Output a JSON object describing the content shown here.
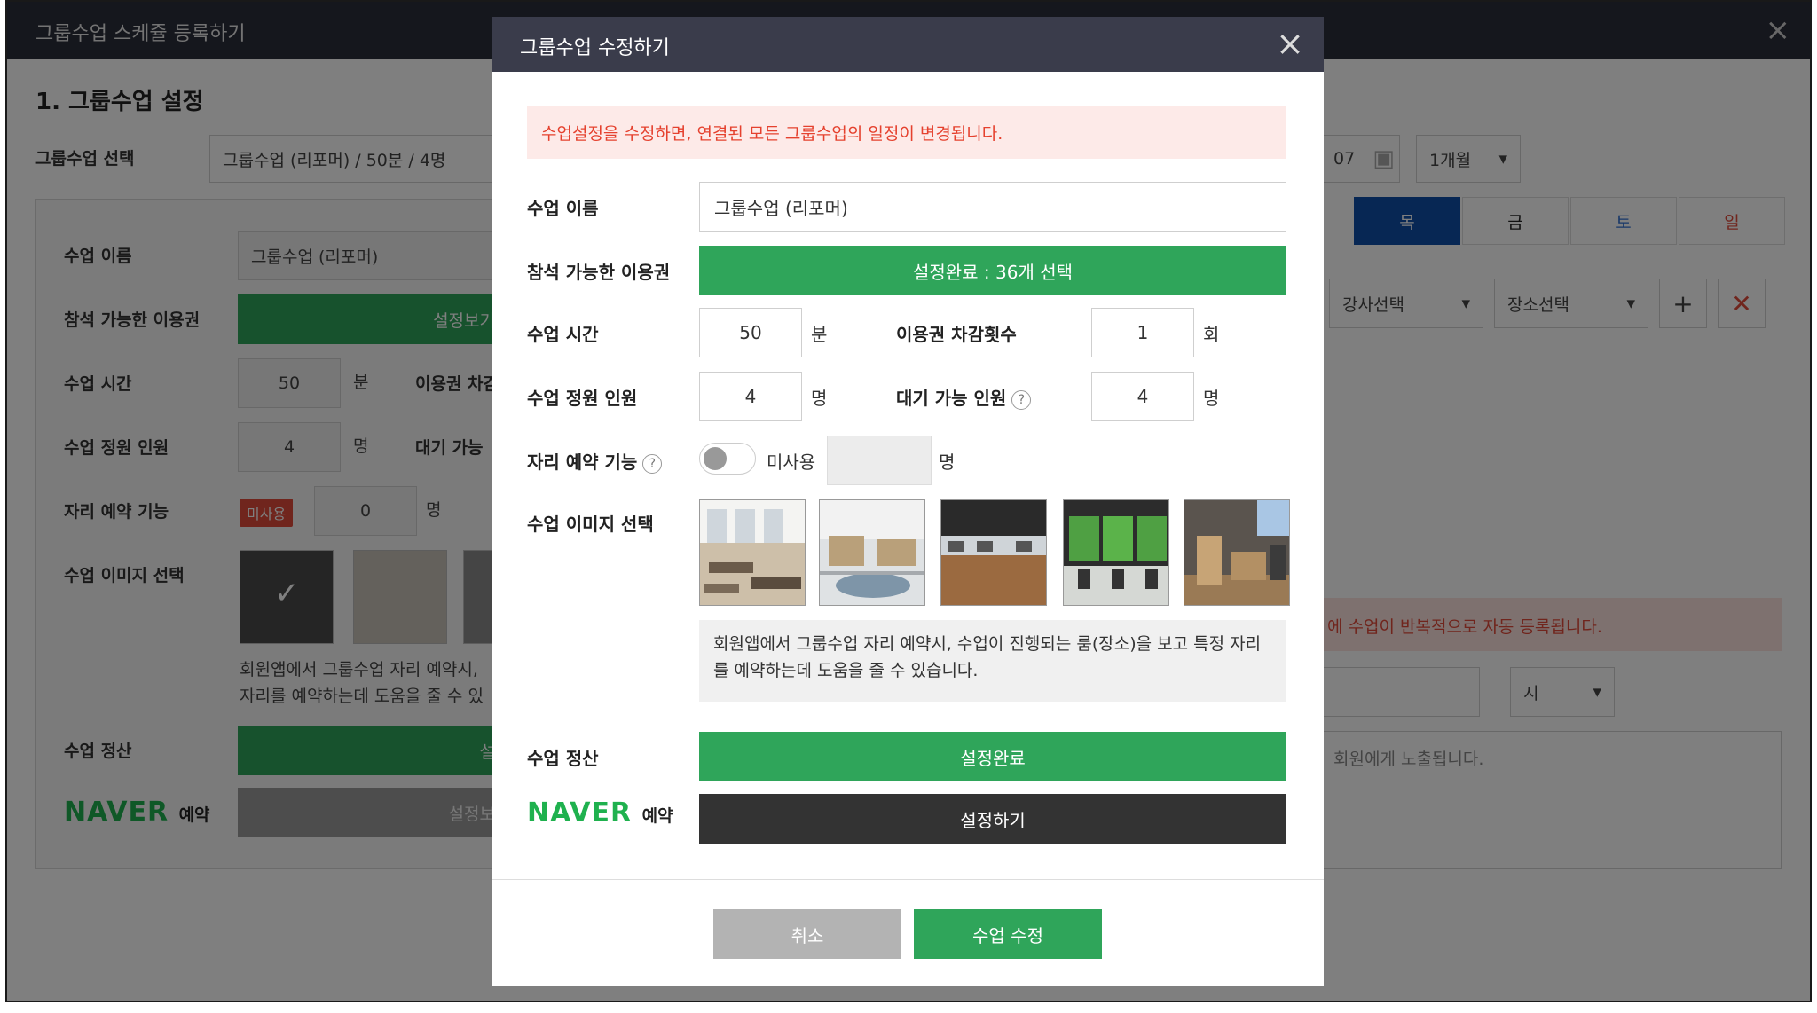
{
  "background": {
    "window_title": "그룹수업 스케쥴 등록하기",
    "close_glyph": "×",
    "section_title": "1. 그룹수업 설정",
    "select_label": "그룹수업 선택",
    "select_value": "그룹수업 (리포머) / 50분 / 4명",
    "date_value": "07",
    "period_select": "1개월",
    "days": [
      "목",
      "금",
      "토",
      "일"
    ],
    "instructor_select": "강사선택",
    "location_select": "장소선택",
    "class_name_label": "수업 이름",
    "class_name_value": "그룹수업 (리포머)",
    "ticket_label": "참석 가능한 이용권",
    "ticket_button": "설정보기",
    "time_label": "수업 시간",
    "time_value": "50",
    "time_unit": "분",
    "deduct_label": "이용권 차감",
    "capacity_label": "수업 정원 인원",
    "capacity_value": "4",
    "capacity_unit": "명",
    "waiting_label": "대기 가능",
    "seat_label": "자리 예약 기능",
    "seat_badge": "미사용",
    "seat_value": "0",
    "seat_unit": "명",
    "image_label": "수업 이미지 선택",
    "image_desc_line1": "회원앱에서 그룹수업 자리 예약시,",
    "image_desc_line2": "자리를 예약하는데 도움을 줄 수 있",
    "settle_label": "수업 정산",
    "settle_button": "설",
    "naver_logo": "NAVER",
    "naver_sub": "예약",
    "naver_button": "설정보",
    "repeat_notice": "에 수업이 반복적으로 자동 등록됩니다.",
    "hour_select": "시",
    "member_notice": "회원에게 노출됩니다."
  },
  "modal": {
    "title": "그룹수업 수정하기",
    "close_glyph": "×",
    "notice": "수업설정을 수정하면, 연결된 모든 그룹수업의 일정이 변경됩니다.",
    "class_name_label": "수업 이름",
    "class_name_value": "그룹수업 (리포머)",
    "ticket_label": "참석 가능한 이용권",
    "ticket_button": "설정완료 : 36개 선택",
    "time_label": "수업 시간",
    "time_value": "50",
    "time_unit": "분",
    "deduct_label": "이용권 차감횟수",
    "deduct_value": "1",
    "deduct_unit": "회",
    "capacity_label": "수업 정원 인원",
    "capacity_value": "4",
    "capacity_unit": "명",
    "waiting_label": "대기 가능 인원",
    "waiting_value": "4",
    "waiting_unit": "명",
    "help_glyph": "?",
    "seat_label": "자리 예약 기능",
    "seat_toggle_on": false,
    "seat_toggle_text": "미사용",
    "seat_unit": "명",
    "image_label": "수업 이미지 선택",
    "image_desc": "회원앱에서 그룹수업 자리 예약시, 수업이 진행되는 룸(장소)을 보고 특정 자리를 예약하는데 도움을 줄 수 있습니다.",
    "settle_label": "수업 정산",
    "settle_button": "설정완료",
    "naver_logo": "NAVER",
    "naver_sub": "예약",
    "naver_button": "설정하기",
    "cancel_button": "취소",
    "submit_button": "수업 수정"
  },
  "colors": {
    "green": "#2fa55a",
    "dark_header": "#3a3c4b",
    "notice_bg": "#fdeae8",
    "notice_text": "#e5412e",
    "naver_green": "#1fb14e"
  }
}
